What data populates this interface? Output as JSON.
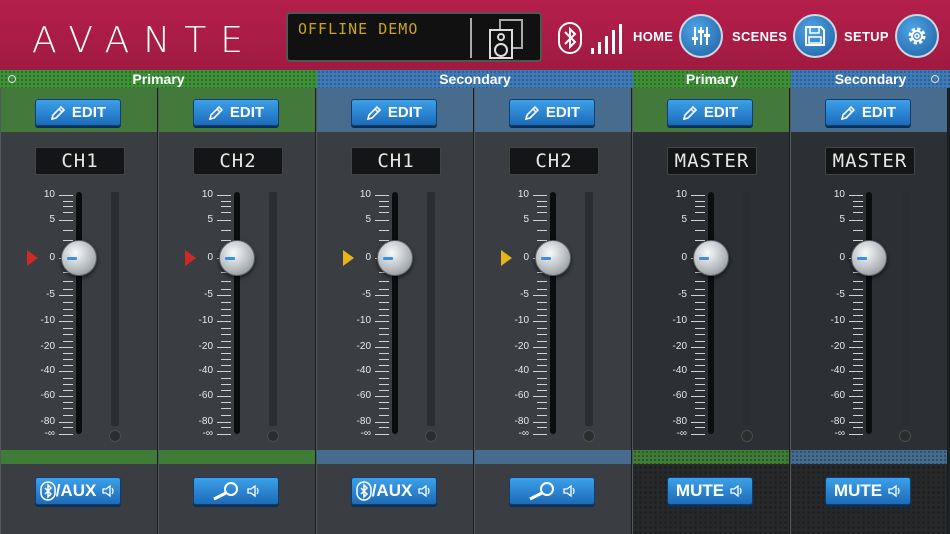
{
  "header": {
    "logo": "AVANTE",
    "lcd_text": "OFFLINE DEMO",
    "nav": [
      {
        "label": "HOME",
        "icon": "sliders-icon"
      },
      {
        "label": "SCENES",
        "icon": "save-icon"
      },
      {
        "label": "SETUP",
        "icon": "gear-icon"
      }
    ]
  },
  "groups": [
    {
      "label": "Primary",
      "color": "#3f8f39"
    },
    {
      "label": "Secondary",
      "color": "#3f7ab5"
    },
    {
      "label": "Primary",
      "color": "#3f8f39"
    },
    {
      "label": "Secondary",
      "color": "#3f7ab5"
    }
  ],
  "scale": [
    "10",
    "5",
    "0",
    "-5",
    "-10",
    "-20",
    "-40",
    "-60",
    "-80",
    "-∞"
  ],
  "strips": [
    {
      "edit_label": "EDIT",
      "name": "CH1",
      "source_label": "/AUX",
      "source_icon": "bluetooth-icon",
      "group": "green",
      "marker": "red"
    },
    {
      "edit_label": "EDIT",
      "name": "CH2",
      "source_label": "",
      "source_icon": "microphone-icon",
      "group": "green",
      "marker": "red"
    },
    {
      "edit_label": "EDIT",
      "name": "CH1",
      "source_label": "/AUX",
      "source_icon": "bluetooth-icon",
      "group": "blue",
      "marker": "yellow"
    },
    {
      "edit_label": "EDIT",
      "name": "CH2",
      "source_label": "",
      "source_icon": "microphone-icon",
      "group": "blue",
      "marker": "yellow"
    },
    {
      "edit_label": "EDIT",
      "name": "MASTER",
      "source_label": "MUTE",
      "source_icon": "",
      "group": "green",
      "marker": ""
    },
    {
      "edit_label": "EDIT",
      "name": "MASTER",
      "source_label": "MUTE",
      "source_icon": "",
      "group": "blue",
      "marker": ""
    }
  ]
}
